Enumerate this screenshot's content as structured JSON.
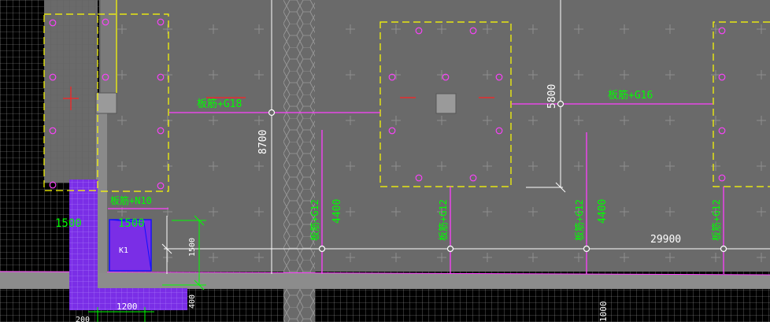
{
  "colors": {
    "background_dark": "#000000",
    "slab_fill": "#6a6a6a",
    "beam": "#ff40ff",
    "column_outline": "#ffff00",
    "text_green": "#00ff00",
    "dimension_white": "#ffffff",
    "hatch_purple": "#7a2ee6",
    "red_marker": "#ff2020"
  },
  "annotations": {
    "beam_g18": "板筋+G18",
    "beam_g16": "板筋+G16",
    "beam_n10": "板筋+N10",
    "beam_g12_a": "板筋+G12",
    "beam_g12_b": "板筋+G12",
    "beam_g12_c": "板筋+G12",
    "beam_g12_d": "板筋+G12",
    "pit_label": "K1"
  },
  "dimensions": {
    "d8700": "8700",
    "d5800": "5800",
    "d4400_a": "4400",
    "d4400_b": "4400",
    "d29900": "29900",
    "d1500_a": "1500",
    "d1500_b": "1500",
    "d1500_v": "1500",
    "d1200": "1200",
    "d400": "400",
    "d1000": "1000",
    "d200": "200"
  }
}
